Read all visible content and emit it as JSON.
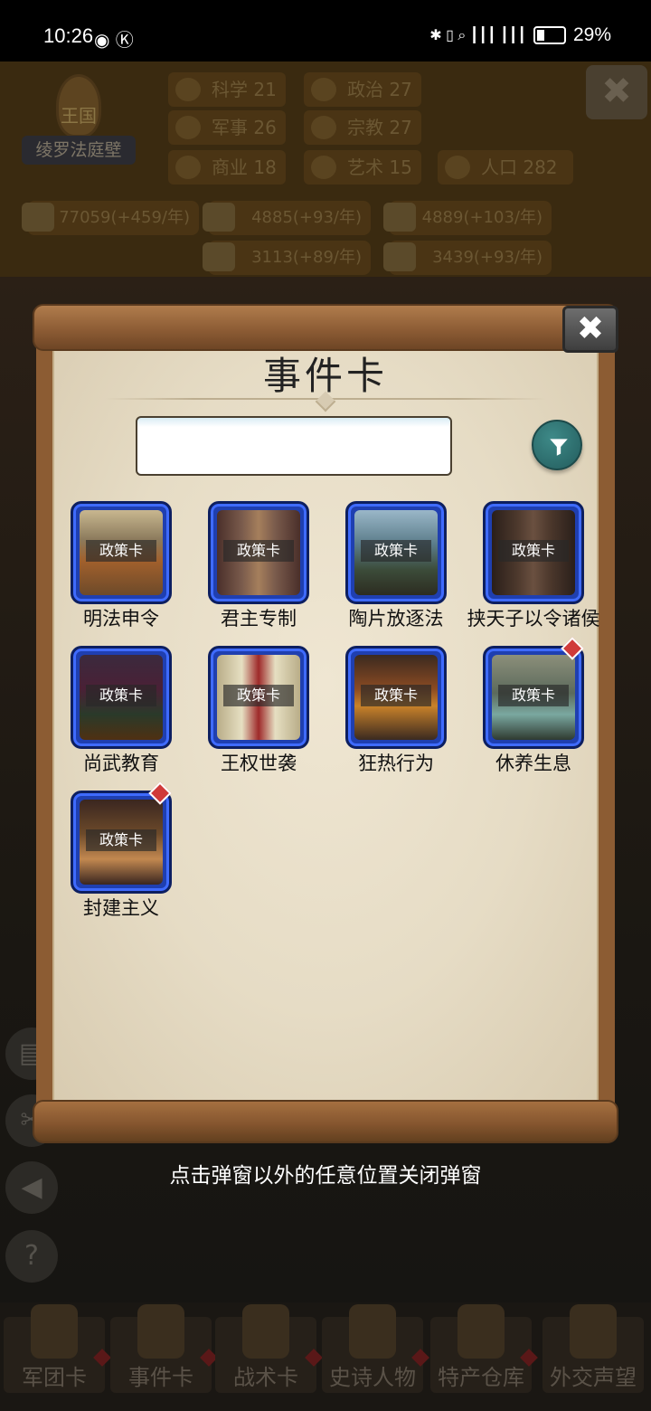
{
  "status_bar": {
    "time": "10:26",
    "left_icons": "◉ Ⓚ",
    "right_icons": "✱ ▯ ⌕ ┃┃┃ ┃┃┃",
    "battery": "29%"
  },
  "background": {
    "kingdom_label": "王国",
    "kingdom_name": "绫罗法庭壁",
    "stats": [
      {
        "label": "科学",
        "value": "21"
      },
      {
        "label": "政治",
        "value": "27"
      },
      {
        "label": "军事",
        "value": "26"
      },
      {
        "label": "宗教",
        "value": "27"
      },
      {
        "label": "商业",
        "value": "18"
      },
      {
        "label": "艺术",
        "value": "15"
      },
      {
        "label": "人口",
        "value": "282"
      }
    ],
    "resources": [
      "77059(+459/年)",
      "4885(+93/年)",
      "4889(+103/年)",
      "3113(+89/年)",
      "3439(+93/年)"
    ],
    "bottom_tabs": [
      "军团卡",
      "事件卡",
      "战术卡",
      "史诗人物",
      "特产仓库",
      "外交声望"
    ]
  },
  "modal": {
    "title": "事件卡",
    "search": {
      "value": "",
      "placeholder": ""
    },
    "cards": [
      {
        "tag": "政策卡",
        "name": "明法申令",
        "new": false
      },
      {
        "tag": "政策卡",
        "name": "君主专制",
        "new": false
      },
      {
        "tag": "政策卡",
        "name": "陶片放逐法",
        "new": false
      },
      {
        "tag": "政策卡",
        "name": "挟天子以令诸侯",
        "new": false
      },
      {
        "tag": "政策卡",
        "name": "尚武教育",
        "new": false
      },
      {
        "tag": "政策卡",
        "name": "王权世袭",
        "new": false
      },
      {
        "tag": "政策卡",
        "name": "狂热行为",
        "new": false
      },
      {
        "tag": "政策卡",
        "name": "休养生息",
        "new": true
      },
      {
        "tag": "政策卡",
        "name": "封建主义",
        "new": true
      }
    ],
    "close_symbol": "✖"
  },
  "hint": "点击弹窗以外的任意位置关闭弹窗",
  "colors": {
    "card_frame": "#1f3fb0",
    "filter_button": "#2f7473",
    "new_badge": "#d03a3a"
  }
}
